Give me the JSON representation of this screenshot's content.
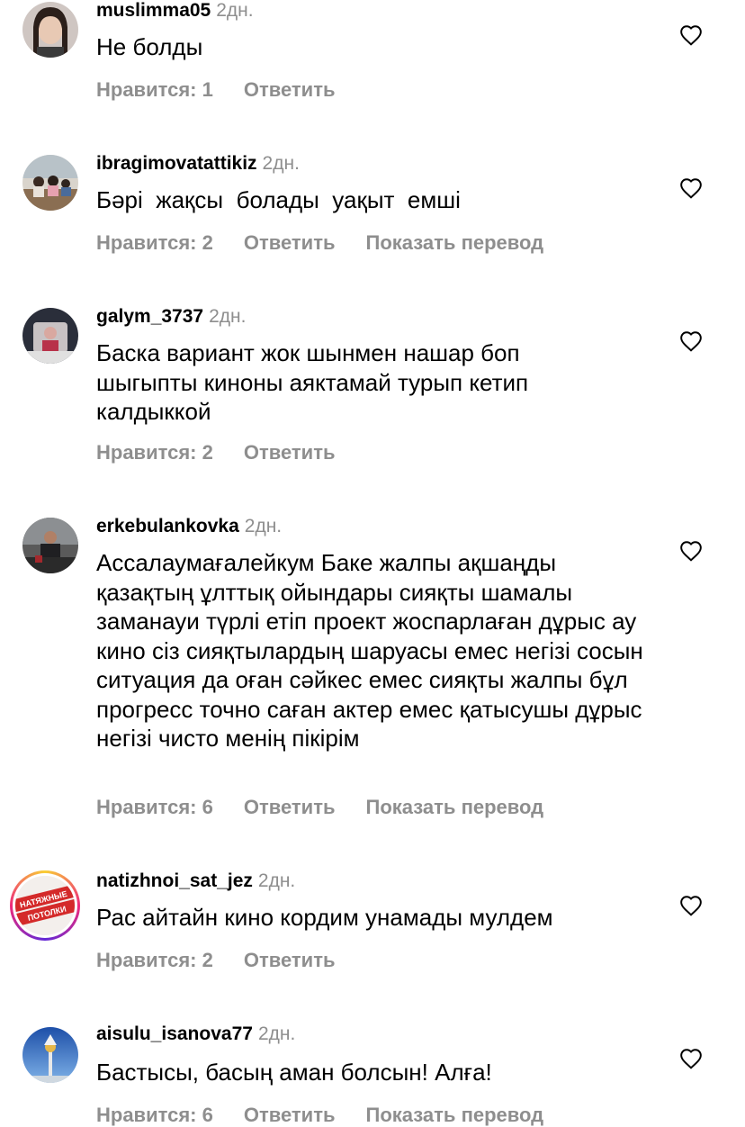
{
  "comments": [
    {
      "username": "muslimma05",
      "time": "2дн.",
      "text": "Не болды",
      "likes": "Нравится: 1",
      "reply": "Ответить",
      "translate": ""
    },
    {
      "username": "ibragimovatattikiz",
      "time": "2дн.",
      "text": "Бәрі  жақсы  болады  уақыт  емші",
      "likes": "Нравится: 2",
      "reply": "Ответить",
      "translate": "Показать перевод"
    },
    {
      "username": "galym_3737",
      "time": "2дн.",
      "text": "Баска вариант жок шынмен нашар боп шыгыпты киноны аяктамай турып кетип калдыккой",
      "likes": "Нравится: 2",
      "reply": "Ответить",
      "translate": ""
    },
    {
      "username": "erkebulankovka",
      "time": "2дн.",
      "text": "Ассалаумағалейкум Баке жалпы ақшаңды қазақтың ұлттық ойындары сияқты шамалы заманауи түрлі етіп проект жоспарлаған дұрыс ау кино сіз сияқтылардың шаруасы емес негізі сосын ситуация да оған сәйкес емес сияқты жалпы бұл прогресс точно саған актер емес қатысушы дұрыс негізі чисто менің пікірім",
      "likes": "Нравится: 6",
      "reply": "Ответить",
      "translate": "Показать перевод"
    },
    {
      "username": "natizhnoi_sat_jez",
      "time": "2дн.",
      "text": "Рас айтайн кино кордим унамады мулдем",
      "likes": "Нравится: 2",
      "reply": "Ответить",
      "translate": "",
      "avatar_text": "НАТЯЖНЫЕ ПОТОЛКИ"
    },
    {
      "username": "aisulu_isanova77",
      "time": "2дн.",
      "text": "Бастысы, басың аман болсын! Алға!",
      "likes": "Нравится: 6",
      "reply": "Ответить",
      "translate": "Показать перевод"
    }
  ],
  "colors": {
    "secondary_text": "#8e8e8e",
    "primary_text": "#000000",
    "background": "#ffffff",
    "story_ring_start": "#f9ce34",
    "story_ring_end": "#ee2a7b"
  },
  "icons": {
    "like": "heart-outline-icon"
  }
}
